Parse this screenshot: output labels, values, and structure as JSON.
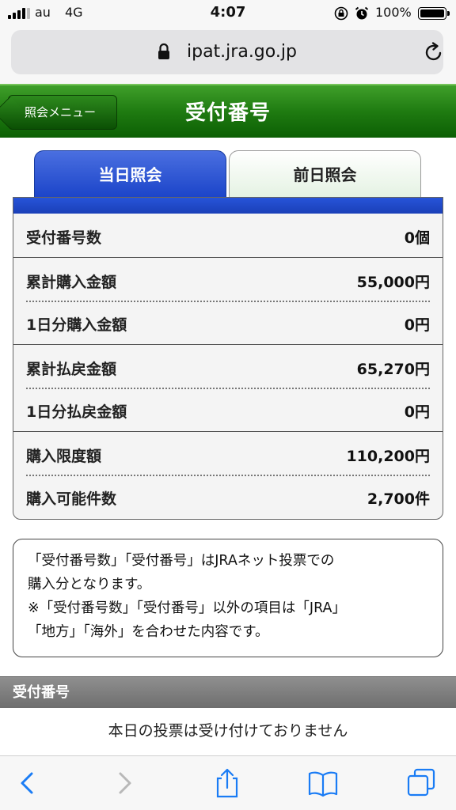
{
  "status": {
    "carrier": "au",
    "network": "4G",
    "time": "4:07",
    "battery": "100%"
  },
  "browser": {
    "url": "ipat.jra.go.jp"
  },
  "header": {
    "back_label": "照会メニュー",
    "title": "受付番号"
  },
  "tabs": [
    {
      "label": "当日照会",
      "active": true
    },
    {
      "label": "前日照会",
      "active": false
    }
  ],
  "rows": [
    {
      "label": "受付番号数",
      "value": "0個"
    },
    {
      "label": "累計購入金額",
      "value": "55,000円"
    },
    {
      "label": "1日分購入金額",
      "value": "0円"
    },
    {
      "label": "累計払戻金額",
      "value": "65,270円"
    },
    {
      "label": "1日分払戻金額",
      "value": "0円"
    },
    {
      "label": "購入限度額",
      "value": "110,200円"
    },
    {
      "label": "購入可能件数",
      "value": "2,700件"
    }
  ],
  "note": {
    "line1": "「受付番号数」「受付番号」はJRAネット投票での",
    "line2": "購入分となります。",
    "line3": "※「受付番号数」「受付番号」以外の項目は「JRA」",
    "line4": "「地方」「海外」を合わせた内容です。"
  },
  "section": {
    "title": "受付番号",
    "message": "本日の投票は受け付けておりません"
  },
  "colors": {
    "header_green": "#1f7b11",
    "tab_blue": "#1b44c9",
    "ios_blue": "#1a7cf5"
  }
}
